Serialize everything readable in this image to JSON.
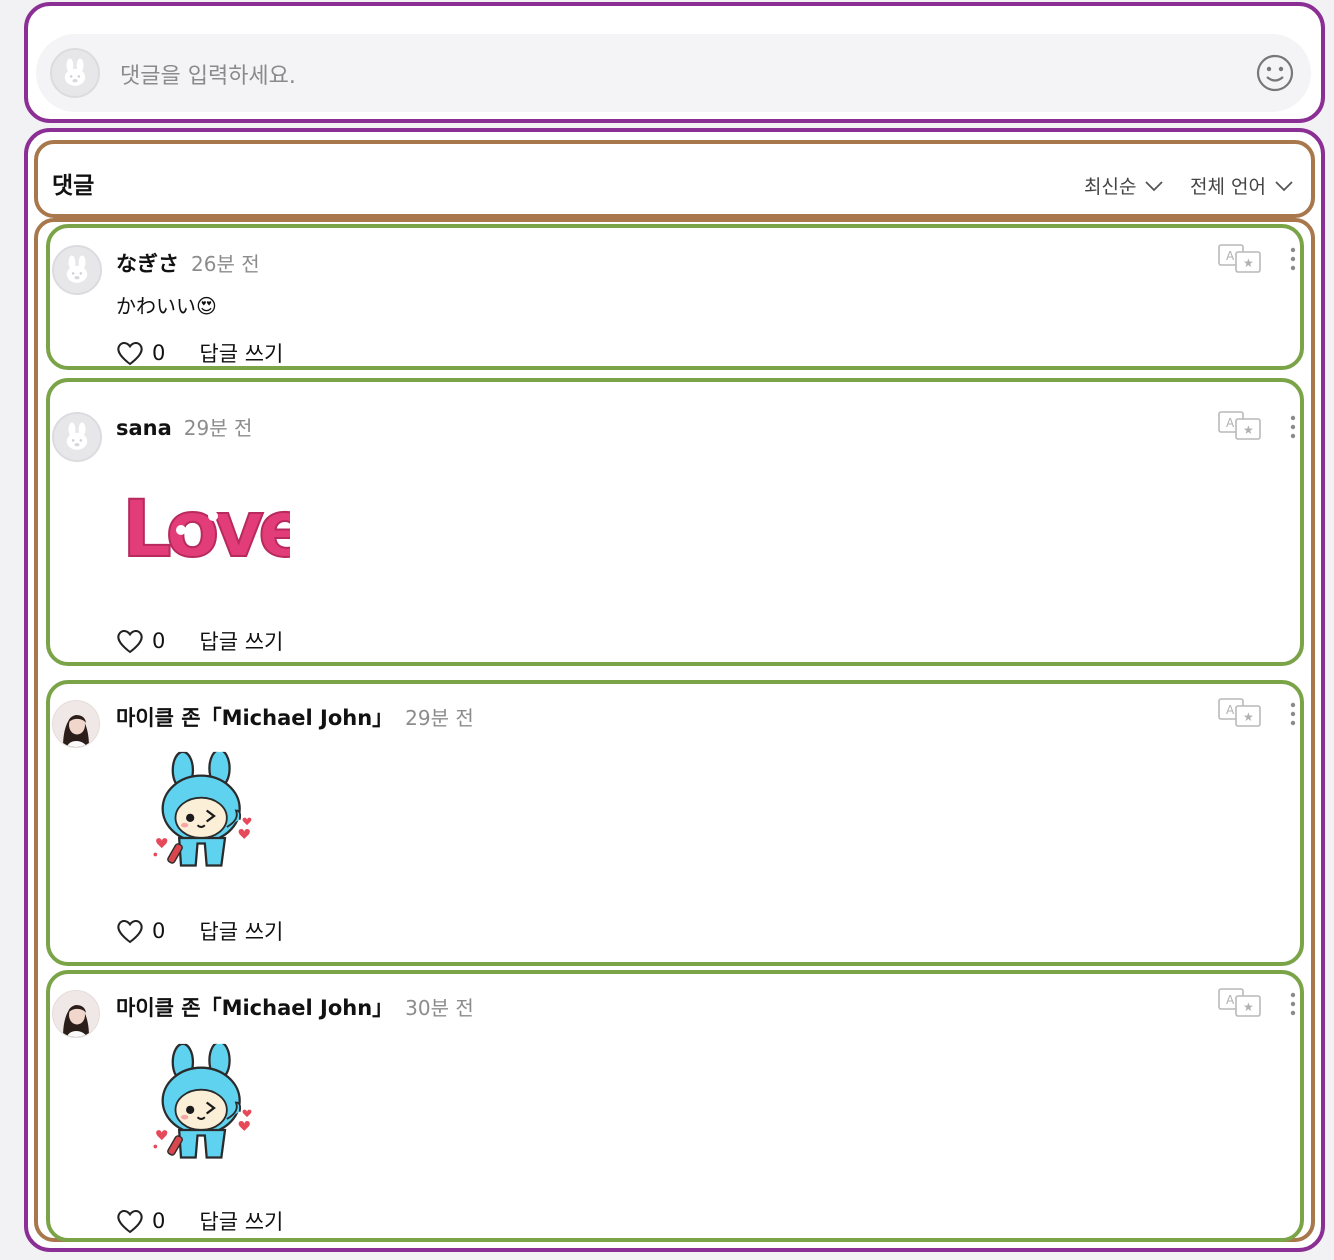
{
  "composer": {
    "placeholder": "댓글을 입력하세요."
  },
  "header": {
    "title": "댓글",
    "sort_label": "최신순",
    "language_label": "전체 언어"
  },
  "comments": [
    {
      "nickname": "なぎさ",
      "time": "26분 전",
      "text": "かわいい😍",
      "likes": "0",
      "reply_label": "답글 쓰기",
      "avatar": "default-rabbit-avatar"
    },
    {
      "nickname": "sana",
      "time": "29분 전",
      "sticker_text": "Love",
      "likes": "0",
      "reply_label": "답글 쓰기",
      "avatar": "default-rabbit-avatar",
      "sticker": "love-sticker"
    },
    {
      "nickname": "마이클 존「Michael John」",
      "time": "29분 전",
      "likes": "0",
      "reply_label": "답글 쓰기",
      "avatar": "profile-photo",
      "sticker": "blue-bunny-sticker"
    },
    {
      "nickname": "마이클 존「Michael John」",
      "time": "30분 전",
      "likes": "0",
      "reply_label": "답글 쓰기",
      "avatar": "profile-photo",
      "sticker": "blue-bunny-sticker"
    }
  ],
  "colors": {
    "outline_purple": "#8b2f95",
    "outline_brown": "#a8774c",
    "outline_green": "#7aa447",
    "love_pink": "#e23d78",
    "bunny_blue": "#5fd2f0"
  }
}
